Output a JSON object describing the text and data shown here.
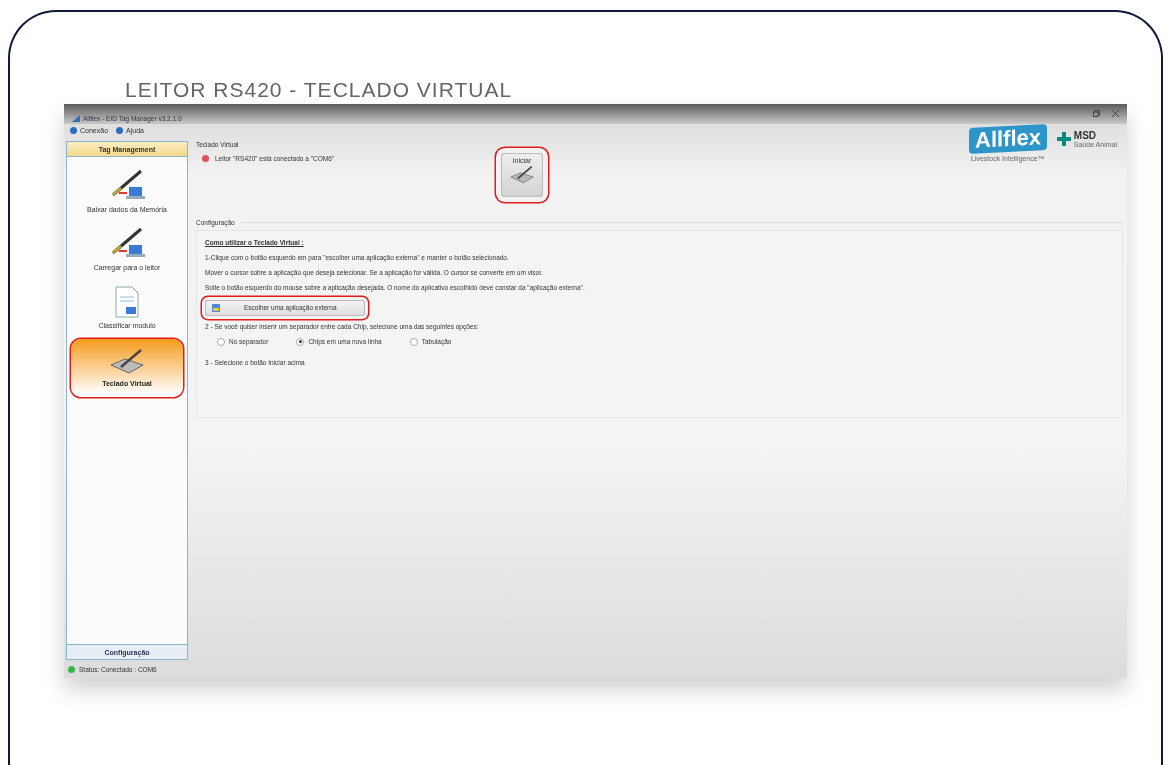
{
  "video_title": "LEITOR RS420 - TECLADO VIRTUAL",
  "window": {
    "title": "Allflex - EID Tag Manager v3.2.1.0"
  },
  "menu": [
    "Conexão",
    "Ajuda"
  ],
  "logo": {
    "brand": "Allflex",
    "tagline": "Livestock Intelligence™",
    "partner": "MSD",
    "partner_tagline": "Saúde Animal"
  },
  "sidebar": {
    "header": "Tag Management",
    "items": [
      {
        "label": "Baixar dados da Memória",
        "kind": "download",
        "selected": false,
        "highlighted": false
      },
      {
        "label": "Carregar para o leitor",
        "kind": "upload",
        "selected": false,
        "highlighted": false
      },
      {
        "label": "Classificar modulo",
        "kind": "document",
        "selected": false,
        "highlighted": false
      },
      {
        "label": "Teclado Virtual",
        "kind": "keyboard",
        "selected": true,
        "highlighted": true
      }
    ],
    "footer": "Configuração"
  },
  "main": {
    "title": "Teclado Virtual",
    "connection": "Leitor \"RS420\" está conectado a \"COM6\"",
    "start_button": {
      "label": "Iniciar",
      "highlighted": true
    }
  },
  "config": {
    "legend": "Configuração",
    "heading": "Como utilizar o Teclado Virtual :",
    "steps": [
      "1-Clique com o botão esquerdo em para \"escolher uma aplicação externa\" e manter o botão selecionado.",
      "Mover o cursor sobre a aplicação que deseja selecionar. Se a aplicação for válida. O cursor se converte em um visor.",
      "Solte o botão esquerdo do mouse sobre a aplicação desejada. O nome do aplicativo escolhido deve constar da \"aplicação externa\"."
    ],
    "choose_button": {
      "label": "Escolher uma aplicação externa",
      "highlighted": true
    },
    "separator_prompt": "2 - Se você quiser inserir um separador entre cada Chip, selecione uma das seguintes opções:",
    "options": [
      {
        "label": "No separador",
        "selected": false
      },
      {
        "label": "Chips em uma nova linha",
        "selected": true
      },
      {
        "label": "Tabulação",
        "selected": false
      }
    ],
    "final_step": "3 - Selecione o botão Iniciar acima"
  },
  "status_bar": "Status: Conectado : COM6"
}
